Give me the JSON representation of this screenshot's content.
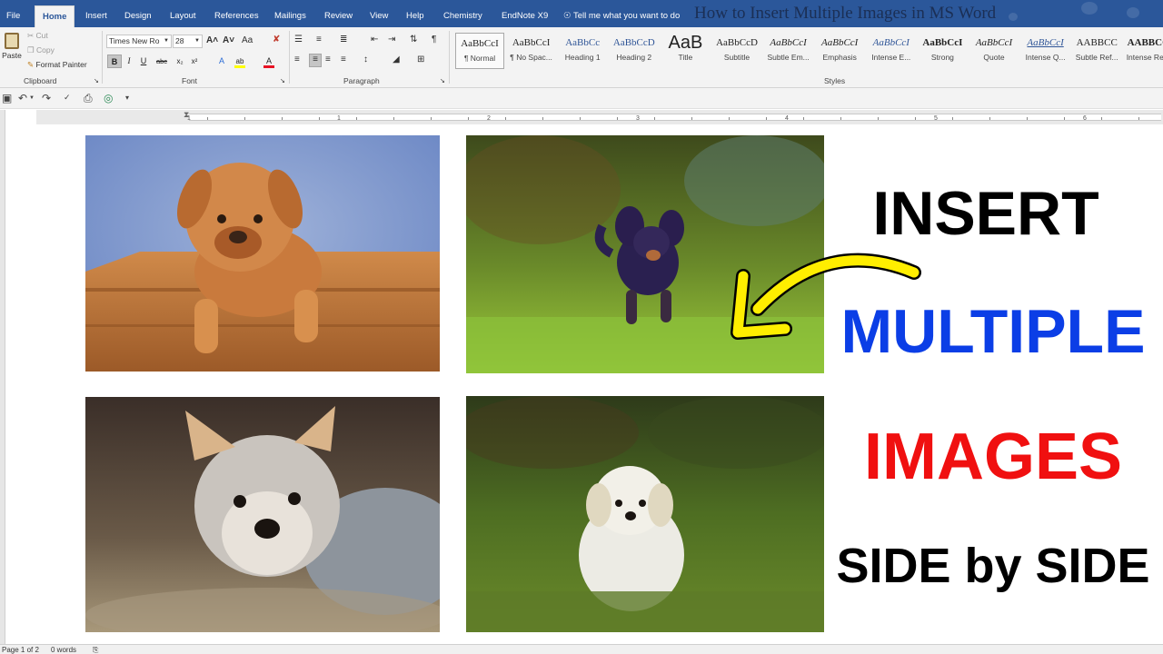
{
  "window": {
    "doc_title": "How to Insert Multiple Images in MS Word"
  },
  "menu": {
    "tabs": [
      "File",
      "Home",
      "Insert",
      "Design",
      "Layout",
      "References",
      "Mailings",
      "Review",
      "View",
      "Help",
      "Chemistry",
      "EndNote X9"
    ],
    "active_tab": "Home",
    "tell_me": "Tell me what you want to do"
  },
  "ribbon": {
    "clipboard": {
      "label": "Clipboard",
      "paste": "Paste",
      "cut": "Cut",
      "copy": "Copy",
      "format_painter": "Format Painter"
    },
    "font": {
      "label": "Font",
      "name": "Times New Ro",
      "size": "28",
      "grow": "A˄",
      "shrink": "A˅",
      "change_case": "Aa",
      "bold": "B",
      "italic": "I",
      "underline": "U",
      "strike": "abc",
      "subscript": "x₂",
      "superscript": "x²",
      "effects": "A",
      "highlight": "ab",
      "color": "A",
      "color_bar": "#e81123",
      "highlight_bar": "#ffff00"
    },
    "paragraph": {
      "label": "Paragraph"
    },
    "styles": {
      "label": "Styles",
      "items": [
        {
          "sample": "AaBbCcI",
          "name": "¶ Normal"
        },
        {
          "sample": "AaBbCcI",
          "name": "¶ No Spac..."
        },
        {
          "sample": "AaBbCc",
          "name": "Heading 1"
        },
        {
          "sample": "AaBbCcD",
          "name": "Heading 2"
        },
        {
          "sample": "AaB",
          "name": "Title"
        },
        {
          "sample": "AaBbCcD",
          "name": "Subtitle"
        },
        {
          "sample": "AaBbCcI",
          "name": "Subtle Em..."
        },
        {
          "sample": "AaBbCcI",
          "name": "Emphasis"
        },
        {
          "sample": "AaBbCcI",
          "name": "Intense E..."
        },
        {
          "sample": "AaBbCcI",
          "name": "Strong"
        },
        {
          "sample": "AaBbCcI",
          "name": "Quote"
        },
        {
          "sample": "AaBbCcI",
          "name": "Intense Q..."
        },
        {
          "sample": "AABBCC",
          "name": "Subtle Ref..."
        },
        {
          "sample": "AABBCC",
          "name": "Intense Re..."
        }
      ]
    }
  },
  "ruler": {
    "numbers": [
      "1",
      "1",
      "2",
      "3",
      "4",
      "5",
      "6"
    ]
  },
  "document": {
    "headline_1": "INSERT",
    "headline_2": "MULTIPLE",
    "headline_3": "IMAGES",
    "headline_4": "SIDE by SIDE",
    "colors": {
      "insert": "#000000",
      "multiple": "#0b3ee6",
      "images": "#f01010",
      "side": "#000000",
      "arrow": "#ffee00"
    }
  },
  "status": {
    "page": "Page 1 of 2",
    "words": "0 words"
  }
}
